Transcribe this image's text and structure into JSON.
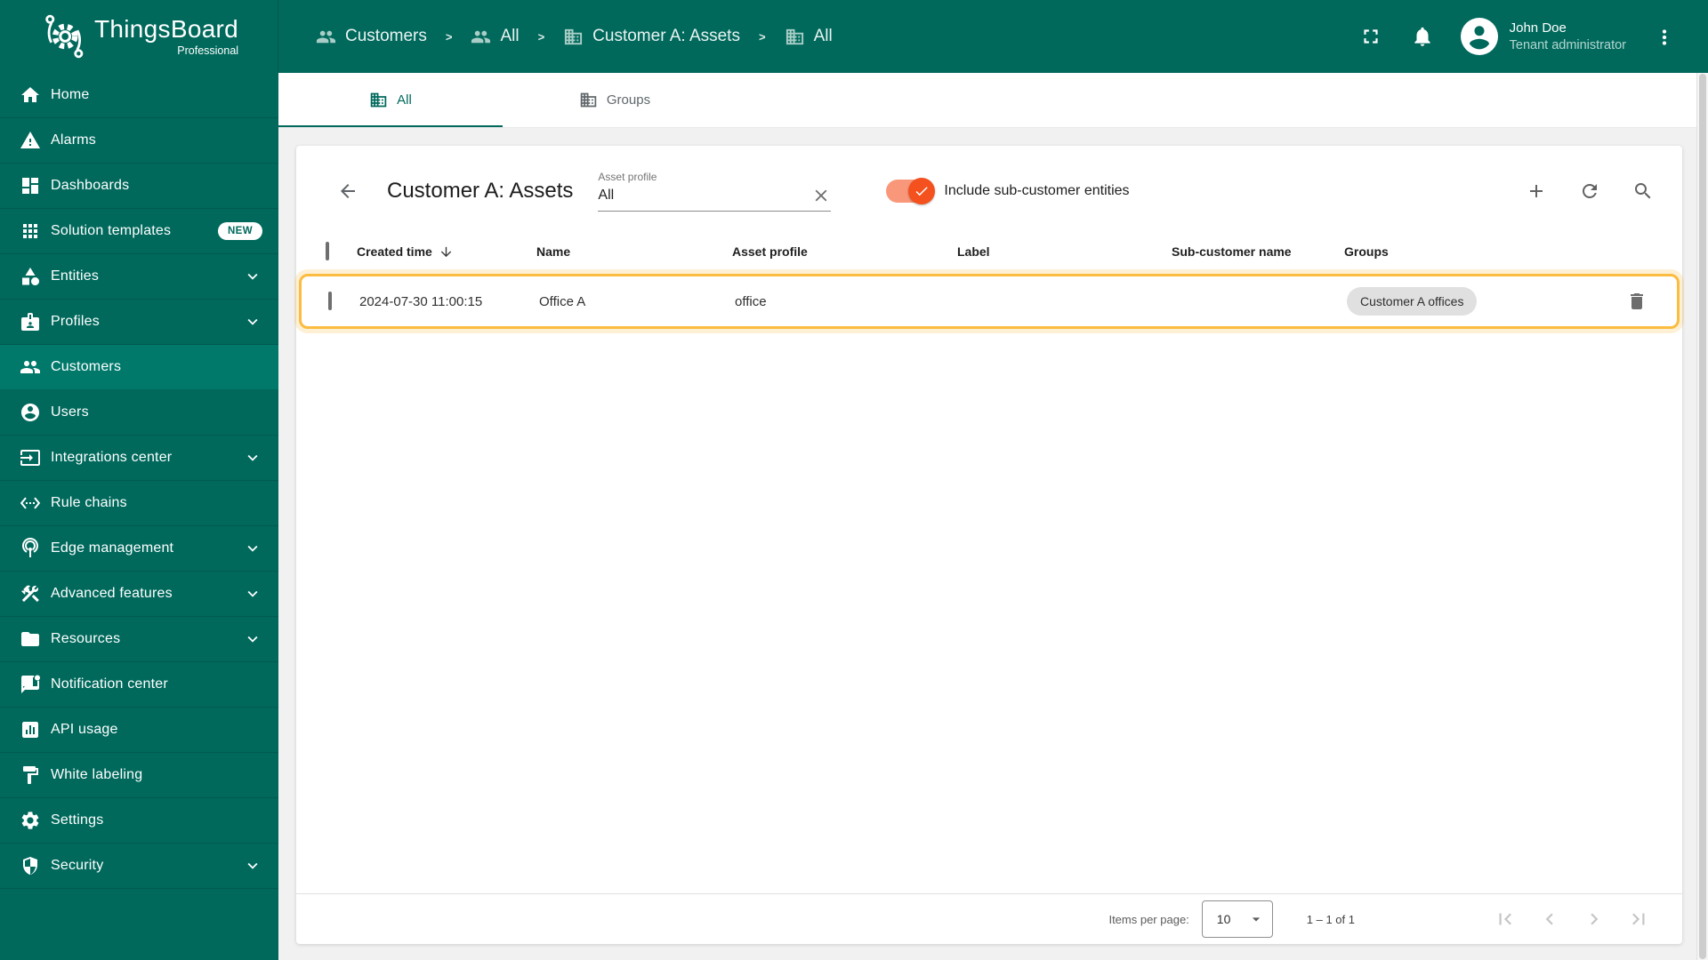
{
  "app": {
    "name": "ThingsBoard",
    "edition": "Professional"
  },
  "colors": {
    "primary": "#00695C",
    "primary_selected": "#00796B",
    "toggle_thumb_orange": "#F4511E",
    "toggle_track_orange": "#F9977A",
    "row_highlight_border": "#FBBC3F",
    "chip_bg": "#E0E0E0"
  },
  "topbar": {
    "breadcrumbs": [
      {
        "label": "Customers",
        "icon": "people-icon"
      },
      {
        "label": "All",
        "icon": "people-icon"
      },
      {
        "label": "Customer A: Assets",
        "icon": "domain-icon"
      },
      {
        "label": "All",
        "icon": "domain-icon"
      }
    ],
    "separator": ">",
    "icons": [
      "fullscreen-icon",
      "bell-icon",
      "avatar",
      "more-vert-icon"
    ],
    "user": {
      "name": "John Doe",
      "role": "Tenant administrator"
    }
  },
  "sidebar": {
    "items": [
      {
        "label": "Home",
        "icon": "home-icon"
      },
      {
        "label": "Alarms",
        "icon": "warning-icon"
      },
      {
        "label": "Dashboards",
        "icon": "dashboard-icon"
      },
      {
        "label": "Solution templates",
        "icon": "apps-icon",
        "badge": "NEW"
      },
      {
        "label": "Entities",
        "icon": "category-icon",
        "expandable": true
      },
      {
        "label": "Profiles",
        "icon": "badge-icon",
        "expandable": true
      },
      {
        "label": "Customers",
        "icon": "people-icon",
        "selected": true
      },
      {
        "label": "Users",
        "icon": "account-icon"
      },
      {
        "label": "Integrations center",
        "icon": "input-icon",
        "expandable": true
      },
      {
        "label": "Rule chains",
        "icon": "ethernet-icon"
      },
      {
        "label": "Edge management",
        "icon": "wifi-tethering-icon",
        "expandable": true
      },
      {
        "label": "Advanced features",
        "icon": "construction-icon",
        "expandable": true
      },
      {
        "label": "Resources",
        "icon": "folder-icon",
        "expandable": true
      },
      {
        "label": "Notification center",
        "icon": "chat-icon"
      },
      {
        "label": "API usage",
        "icon": "analytics-icon"
      },
      {
        "label": "White labeling",
        "icon": "paint-icon"
      },
      {
        "label": "Settings",
        "icon": "settings-icon"
      },
      {
        "label": "Security",
        "icon": "shield-icon",
        "expandable": true
      }
    ]
  },
  "tabs": [
    {
      "label": "All",
      "icon": "domain-icon",
      "active": true
    },
    {
      "label": "Groups",
      "icon": "domain-icon",
      "active": false
    }
  ],
  "panel": {
    "title": "Customer A: Assets",
    "filter": {
      "label": "Asset profile",
      "value": "All"
    },
    "toggle": {
      "label": "Include sub-customer entities",
      "checked": true
    }
  },
  "table": {
    "columns": [
      "Created time",
      "Name",
      "Asset profile",
      "Label",
      "Sub-customer name",
      "Groups"
    ],
    "sort": {
      "column": "Created time",
      "direction": "desc"
    },
    "rows": [
      {
        "created_time": "2024-07-30 11:00:15",
        "name": "Office A",
        "asset_profile": "office",
        "label": "",
        "sub_customer_name": "",
        "groups": [
          "Customer A offices"
        ],
        "highlighted": true
      }
    ]
  },
  "pagination": {
    "items_per_page_label": "Items per page:",
    "items_per_page": "10",
    "range": "1 – 1 of 1"
  }
}
